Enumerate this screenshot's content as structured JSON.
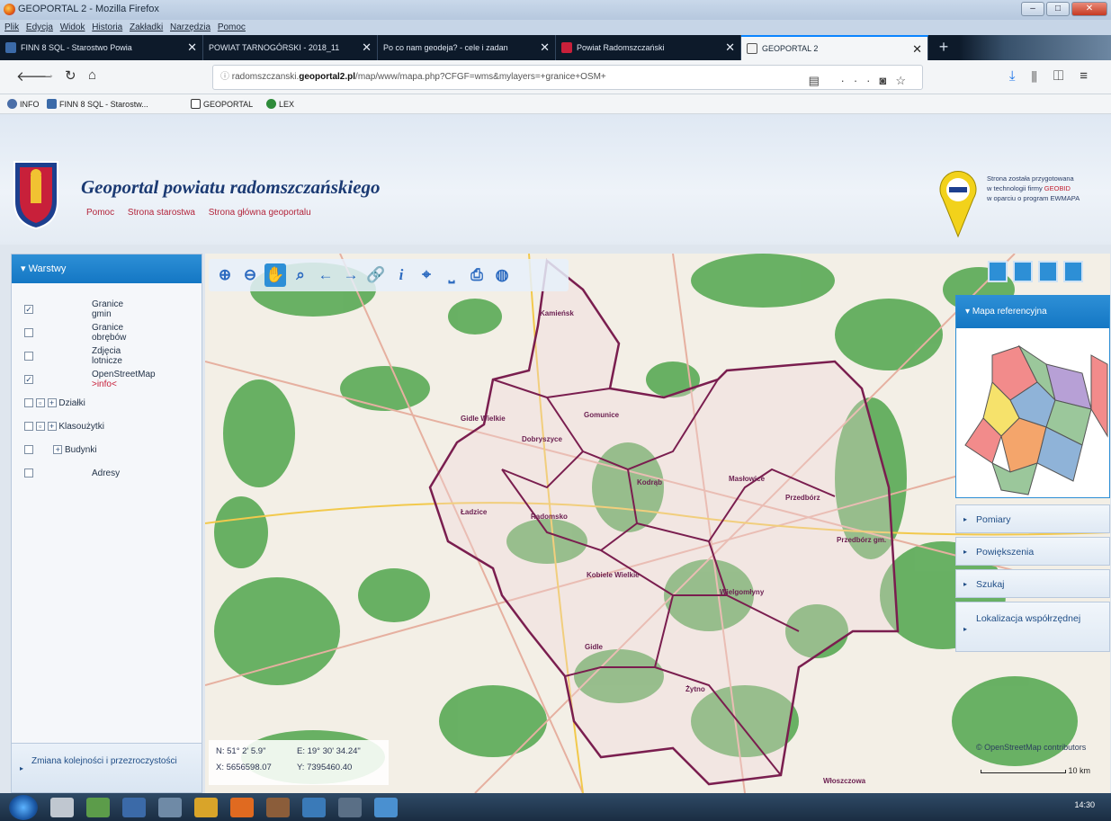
{
  "window": {
    "title": "GEOPORTAL 2 - Mozilla Firefox"
  },
  "menu": [
    "Plik",
    "Edycja",
    "Widok",
    "Historia",
    "Zakładki",
    "Narzędzia",
    "Pomoc"
  ],
  "tabs": [
    {
      "label": "FINN 8 SQL - Starostwo Powia"
    },
    {
      "label": "POWIAT TARNOGÓRSKI - 2018_11"
    },
    {
      "label": "Po co nam geodeja? - cele i zadan"
    },
    {
      "label": "Powiat Radomszczański"
    },
    {
      "label": "GEOPORTAL 2"
    }
  ],
  "url": {
    "prefix": "radomszczanski.",
    "host": "geoportal2.pl",
    "path": "/map/www/mapa.php?CFGF=wms&mylayers=+granice+OSM+"
  },
  "bookmarks": [
    "INFO",
    "FINN 8 SQL - Starostw...",
    "GEOPORTAL",
    "LEX"
  ],
  "header": {
    "title": "Geoportal powiatu radomszczańskiego",
    "links": [
      "Pomoc",
      "Strona starostwa",
      "Strona główna geoportalu"
    ],
    "credit": [
      "Strona została przygotowana",
      "w technologii firmy",
      "GEOBID",
      "w oparciu o program EWMAPA"
    ]
  },
  "layers_panel": {
    "title": "Warstwy",
    "items": [
      {
        "label": "Granice gmin",
        "checked": true
      },
      {
        "label": "Granice obrębów",
        "checked": false
      },
      {
        "label": "Zdjęcia lotnicze",
        "checked": false
      },
      {
        "label": "OpenStreetMap",
        "suffix": ">info<",
        "checked": true
      },
      {
        "label": "Działki",
        "checked": false
      },
      {
        "label": "Klasoużytki",
        "checked": false
      },
      {
        "label": "Budynki",
        "checked": false
      },
      {
        "label": "Adresy",
        "checked": false
      }
    ],
    "footer": "Zmiana kolejności i przezroczystości"
  },
  "coords": {
    "lat": "N: 51° 2' 5.9\"",
    "lon": "E: 19° 30' 34.24\"",
    "x": "X: 5656598.07",
    "y": "Y: 7395460.40"
  },
  "right_panel": {
    "ref_title": "Mapa referencyjna",
    "items": [
      "Pomiary",
      "Powiększenia",
      "Szukaj",
      "Lokalizacja współrzędnej"
    ]
  },
  "map": {
    "attribution": "© OpenStreetMap contributors",
    "scale": "10 km",
    "towns": [
      "Kamieńsk",
      "Gomunice",
      "Gidle Wielkie",
      "Dobryszyce",
      "Radomsko",
      "Ładzice",
      "Kodrąb",
      "Masłowice",
      "Przedbórz",
      "Kobiele Wielkie",
      "Wielgomłyny",
      "Gidle",
      "Żytno",
      "Przedbórz gm.",
      "Włoszczowa"
    ]
  },
  "taskbar": {
    "time": "14:30"
  },
  "colors": {
    "accent": "#2d8fd6",
    "boundary": "#7a1e4f",
    "forest": "#4ea64e"
  }
}
